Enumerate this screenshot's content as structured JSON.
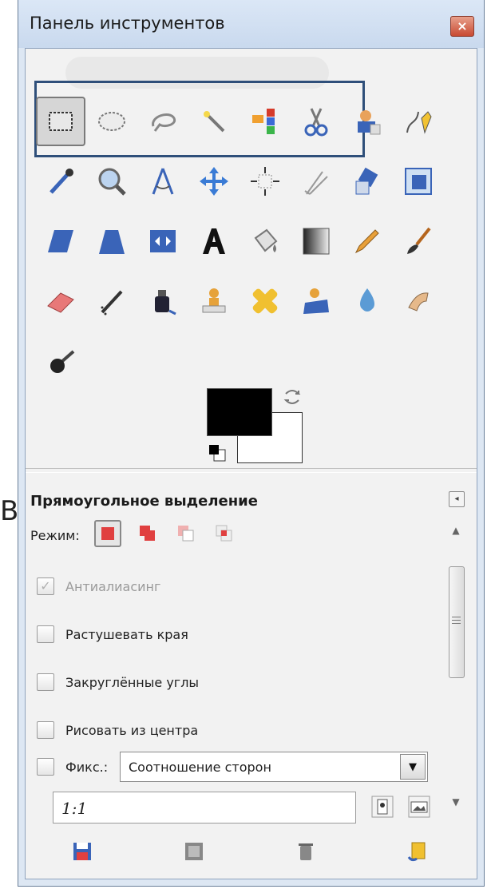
{
  "window": {
    "title": "Панель инструментов",
    "close_symbol": "×"
  },
  "side_glyph": "В",
  "tools": [
    {
      "name": "rect-select-icon",
      "active": true
    },
    {
      "name": "ellipse-select-icon"
    },
    {
      "name": "lasso-icon"
    },
    {
      "name": "fuzzy-select-icon"
    },
    {
      "name": "color-select-icon"
    },
    {
      "name": "scissors-select-icon"
    },
    {
      "name": "foreground-select-icon"
    },
    {
      "name": "paths-icon"
    },
    {
      "name": "color-picker-icon"
    },
    {
      "name": "zoom-icon"
    },
    {
      "name": "measure-icon"
    },
    {
      "name": "move-icon"
    },
    {
      "name": "align-icon"
    },
    {
      "name": "crop-icon"
    },
    {
      "name": "rotate-icon"
    },
    {
      "name": "scale-icon"
    },
    {
      "name": "shear-icon"
    },
    {
      "name": "perspective-icon"
    },
    {
      "name": "flip-icon"
    },
    {
      "name": "text-icon"
    },
    {
      "name": "bucket-fill-icon"
    },
    {
      "name": "blend-icon"
    },
    {
      "name": "pencil-icon"
    },
    {
      "name": "paintbrush-icon"
    },
    {
      "name": "eraser-icon"
    },
    {
      "name": "airbrush-icon"
    },
    {
      "name": "ink-icon"
    },
    {
      "name": "clone-icon"
    },
    {
      "name": "heal-icon"
    },
    {
      "name": "perspective-clone-icon"
    },
    {
      "name": "blur-sharpen-icon"
    },
    {
      "name": "smudge-icon"
    },
    {
      "name": "dodge-burn-icon"
    }
  ],
  "colors": {
    "foreground": "#000000",
    "background": "#ffffff",
    "accent_box": "#2f4f7a"
  },
  "options": {
    "title": "Прямоугольное выделение",
    "mode_label": "Режим:",
    "antialias_label": "Антиалиасинг",
    "antialias_checked": true,
    "antialias_mark": "✓",
    "feather_label": "Растушевать края",
    "rounded_label": "Закруглённые углы",
    "center_label": "Рисовать из центра",
    "fixed_label": "Фикс.:",
    "fixed_select_value": "Соотношение сторон",
    "ratio_value": "1:1",
    "collapse_symbol": "◂",
    "select_arrow": "▼",
    "scroll_up": "▲",
    "scroll_down": "▼"
  }
}
